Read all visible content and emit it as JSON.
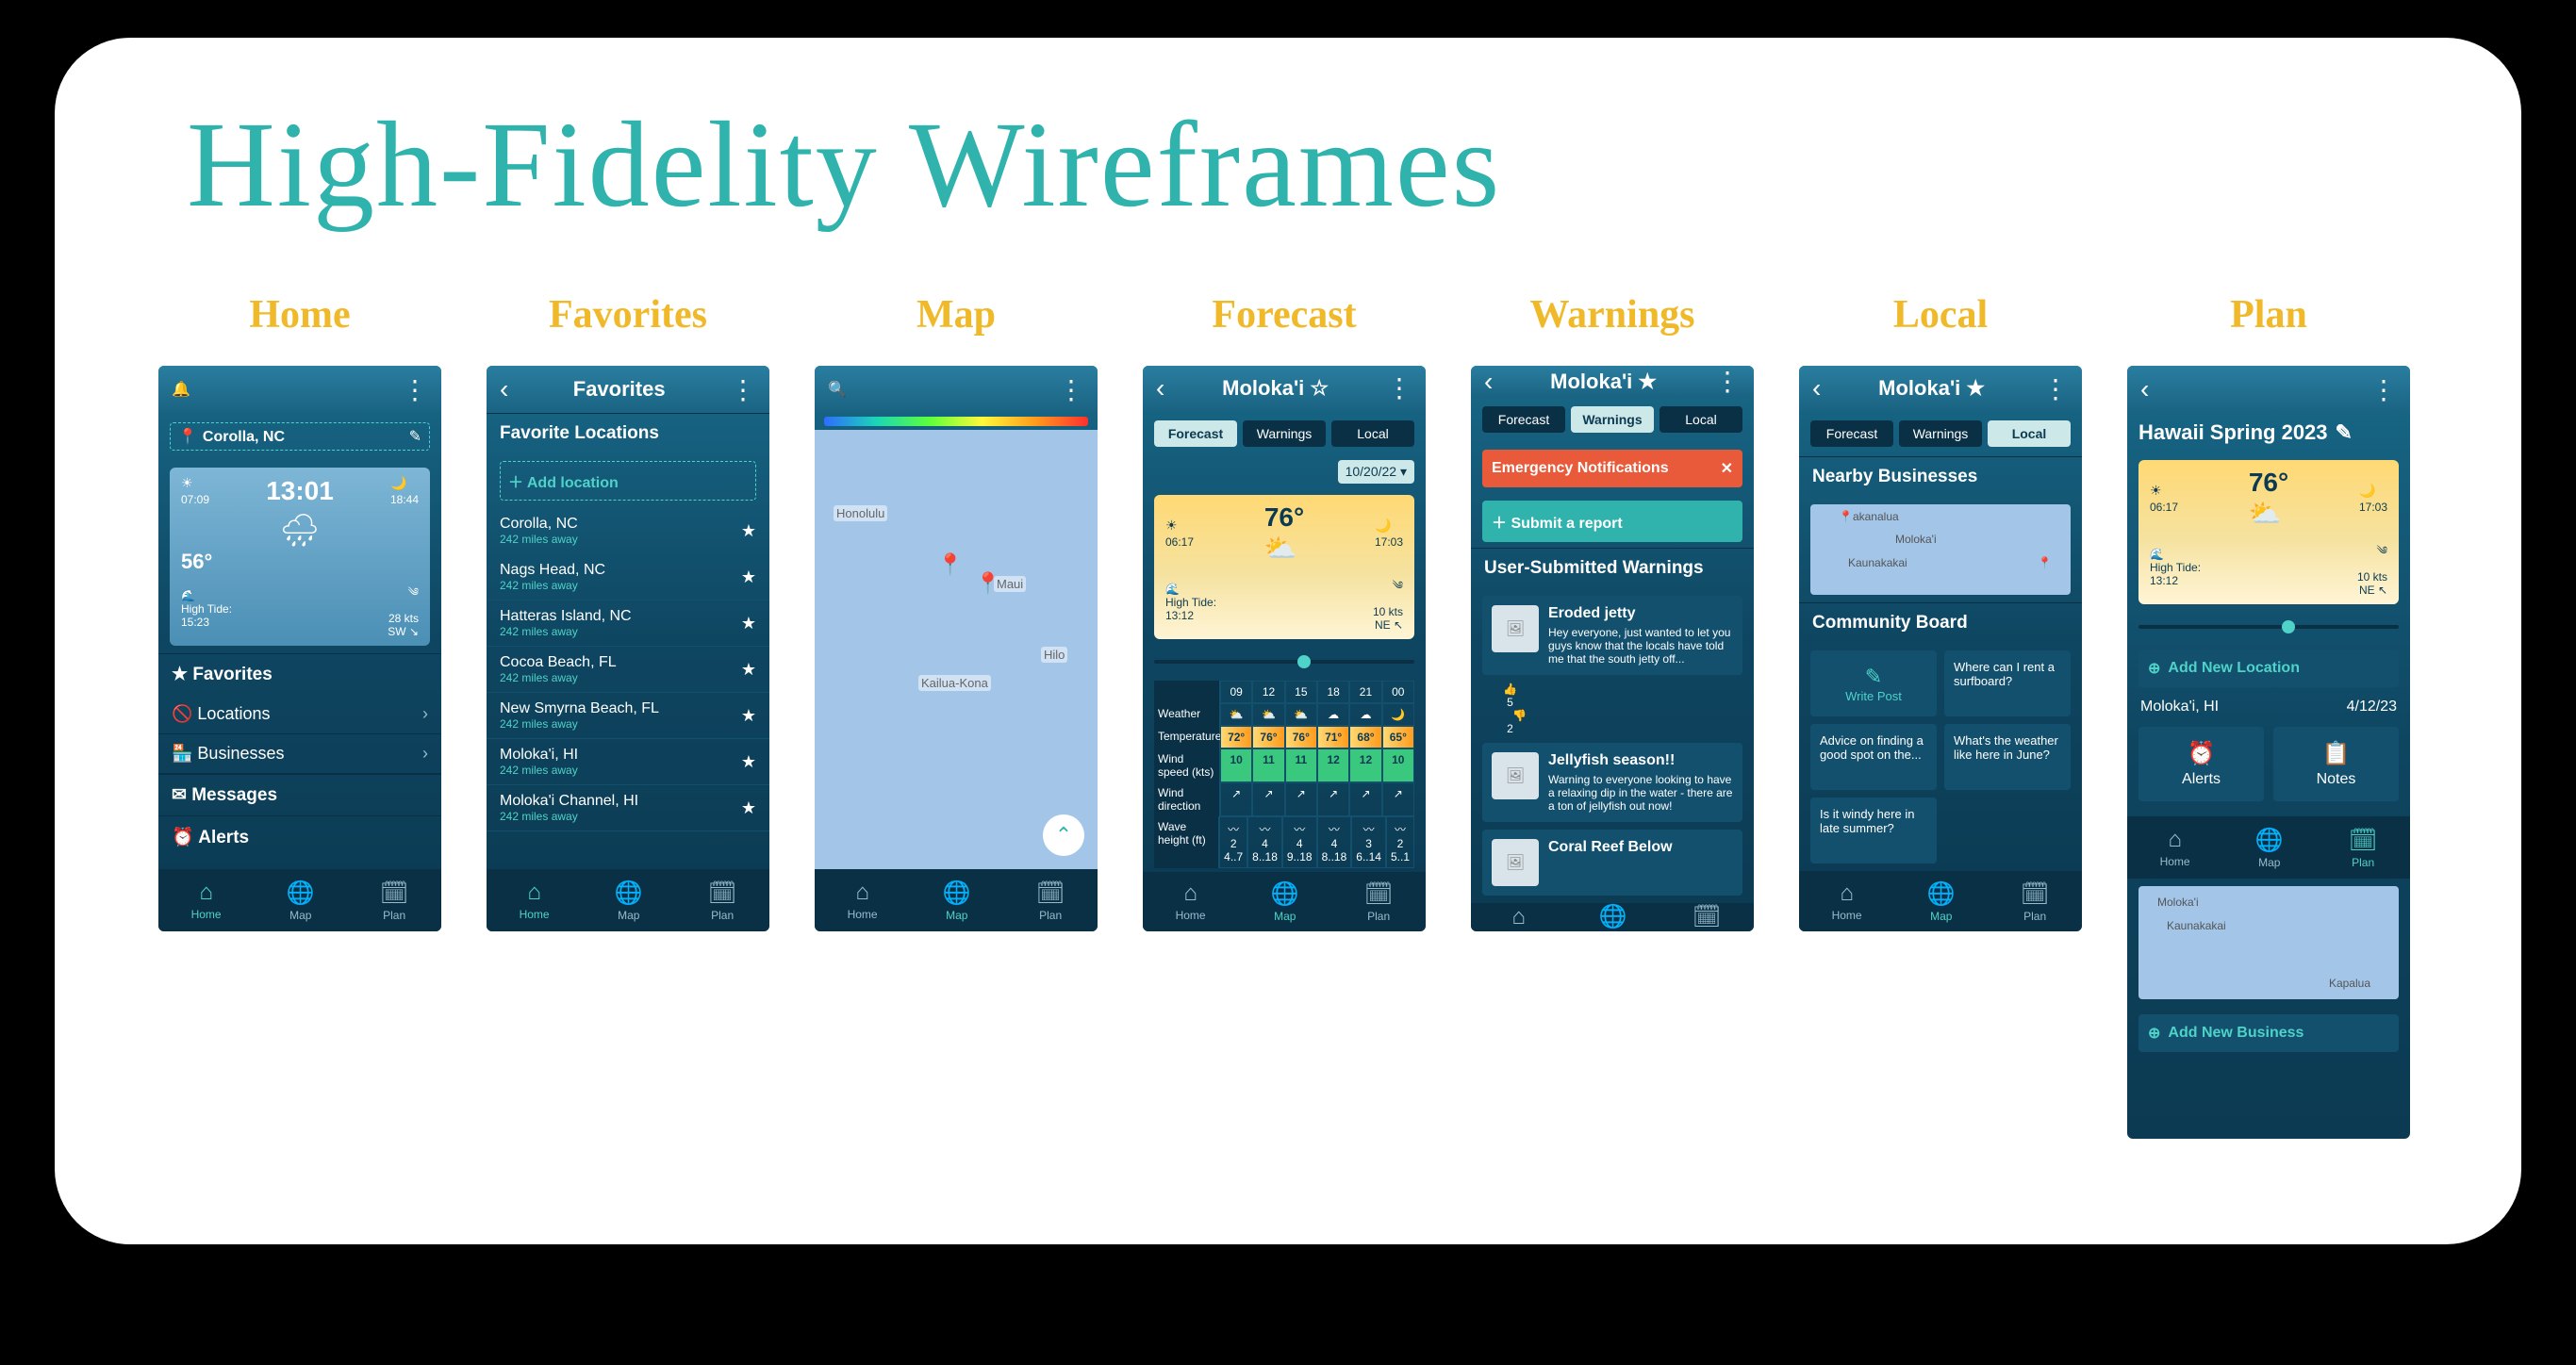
{
  "page_title": "High-Fidelity Wireframes",
  "labels": [
    "Home",
    "Favorites",
    "Map",
    "Forecast",
    "Warnings",
    "Local",
    "Plan"
  ],
  "nav": {
    "home": "Home",
    "map": "Map",
    "plan": "Plan"
  },
  "home": {
    "location": "Corolla, NC",
    "time": "13:01",
    "temp": "56°",
    "sunrise": "07:09",
    "sunset": "18:44",
    "tide_label": "High Tide:",
    "tide_time": "15:23",
    "wind": "28 kts",
    "wind_dir": "SW ↘",
    "favorites": "Favorites",
    "locations": "Locations",
    "businesses": "Businesses",
    "messages": "Messages",
    "alerts": "Alerts"
  },
  "favorites": {
    "title": "Favorites",
    "header": "Favorite Locations",
    "add": "Add location",
    "items": [
      {
        "name": "Corolla, NC",
        "dist": "242 miles away"
      },
      {
        "name": "Nags Head, NC",
        "dist": "242 miles away"
      },
      {
        "name": "Hatteras Island, NC",
        "dist": "242 miles away"
      },
      {
        "name": "Cocoa Beach, FL",
        "dist": "242 miles away"
      },
      {
        "name": "New Smyrna Beach, FL",
        "dist": "242 miles away"
      },
      {
        "name": "Moloka'i, HI",
        "dist": "242 miles away"
      },
      {
        "name": "Moloka'i Channel, HI",
        "dist": "242 miles away"
      }
    ]
  },
  "map": {
    "labels": {
      "honolulu": "Honolulu",
      "kailua": "Kailua-Kona",
      "hilo": "Hilo",
      "maui": "Maui"
    }
  },
  "forecast": {
    "title": "Moloka'i",
    "tabs": {
      "forecast": "Forecast",
      "warnings": "Warnings",
      "local": "Local"
    },
    "date": "10/20/22 ▾",
    "temp": "76°",
    "sunrise": "06:17",
    "sunset": "17:03",
    "tide_label": "High Tide:",
    "tide_time": "13:12",
    "wind": "10 kts",
    "wind_dir": "NE ↖",
    "hours": [
      "09",
      "12",
      "15",
      "18",
      "21",
      "00"
    ],
    "rows": {
      "weather": "Weather",
      "temperature": "Temperature",
      "wind_speed": "Wind speed (kts)",
      "wind_direction": "Wind direction",
      "wave_height": "Wave height (ft)"
    },
    "temps": [
      "72°",
      "76°",
      "76°",
      "71°",
      "68°",
      "65°"
    ],
    "winds": [
      "10",
      "11",
      "11",
      "12",
      "12",
      "10"
    ],
    "waves": [
      "2",
      "4",
      "4",
      "4",
      "3",
      "2"
    ],
    "wave_ranges": [
      "4..7",
      "8..18",
      "9..18",
      "8..18",
      "6..14",
      "5..1"
    ]
  },
  "warnings": {
    "title": "Moloka'i",
    "emergency": "Emergency Notifications",
    "submit": "Submit a report",
    "header": "User-Submitted Warnings",
    "items": [
      {
        "title": "Eroded jetty",
        "body": "Hey everyone, just wanted to let you guys know that the locals have told me that the south jetty off...",
        "up": "5",
        "dn": "2"
      },
      {
        "title": "Jellyfish season!!",
        "body": "Warning to everyone looking to have a relaxing dip in the water - there are a ton of jellyfish out now!"
      },
      {
        "title": "Coral Reef Below",
        "body": ""
      }
    ]
  },
  "local": {
    "title": "Moloka'i",
    "nearby": "Nearby Businesses",
    "board": "Community Board",
    "write": "Write Post",
    "posts": [
      "Where can I rent a surfboard?",
      "Advice on finding a good spot on the...",
      "What's the weather like here in June?",
      "Is it windy here in late summer?"
    ],
    "map_labels": {
      "akanalua": "akanalua",
      "molokai": "Moloka'i",
      "kaunakakai": "Kaunakakai"
    }
  },
  "plan": {
    "title": "Hawaii Spring 2023",
    "temp": "76°",
    "sunrise": "06:17",
    "sunset": "17:03",
    "tide_label": "High Tide:",
    "tide_time": "13:12",
    "wind": "10 kts",
    "wind_dir": "NE ↖",
    "add_location": "Add New Location",
    "loc": "Moloka'i, HI",
    "loc_date": "4/12/23",
    "alerts": "Alerts",
    "notes": "Notes",
    "add_business": "Add New Business",
    "map_labels": {
      "molokai": "Moloka'i",
      "kaunakakai": "Kaunakakai",
      "kapalua": "Kapalua"
    }
  }
}
